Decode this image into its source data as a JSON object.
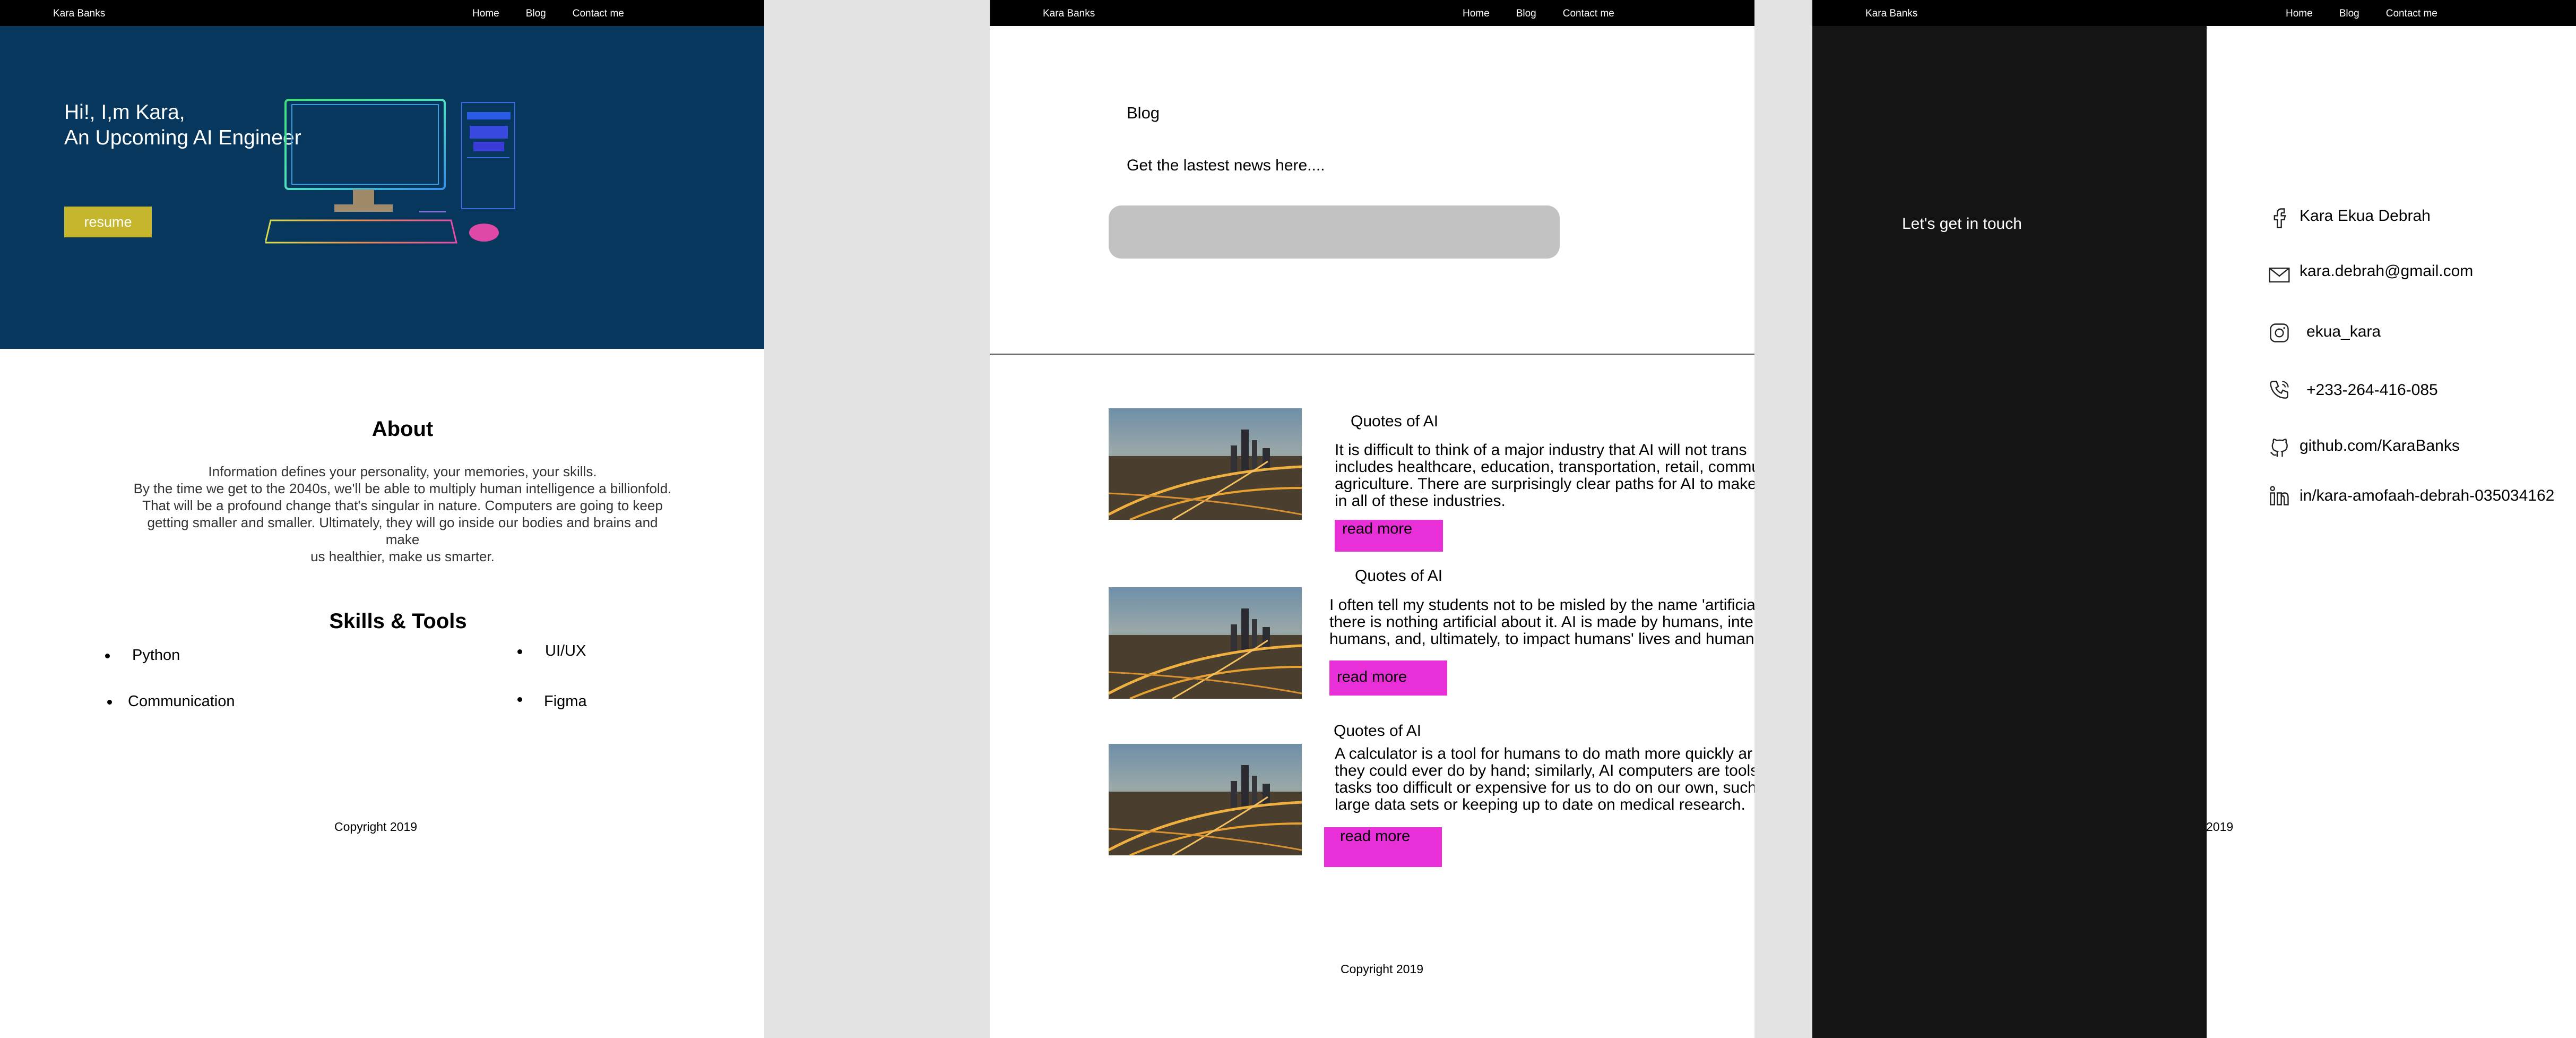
{
  "nav": {
    "brand": "Kara Banks",
    "links": [
      "Home",
      "Blog",
      "Contact me"
    ]
  },
  "home": {
    "hero_line1": "Hi!, I,m Kara,",
    "hero_line2": "An Upcoming AI Engineer",
    "resume_label": "resume",
    "about_title": "About",
    "about_lines": [
      "Information defines your personality, your memories, your skills.",
      "By the time we get to the 2040s, we'll be able to multiply human intelligence a billionfold.",
      "That will be a profound change that's singular in nature. Computers are going to keep",
      "getting smaller and smaller. Ultimately, they will go inside our bodies and brains and make",
      "us healthier, make us smarter."
    ],
    "skills_title": "Skills & Tools",
    "skills": [
      "Python",
      "UI/UX",
      "Communication",
      "Figma"
    ],
    "copyright": "Copyright 2019"
  },
  "blog": {
    "title": "Blog",
    "subtitle": "Get the lastest news here....",
    "posts": [
      {
        "title": "Quotes of AI",
        "lines": [
          "It is difficult to think of a major industry that AI will not trans",
          "includes healthcare, education, transportation, retail, commu",
          "agriculture. There are surprisingly clear paths for AI to make",
          "in all of these industries."
        ],
        "button": "read more"
      },
      {
        "title": "Quotes of AI",
        "lines": [
          "I often tell my students not to be misled by the name 'artificia",
          "there is nothing artificial about it. AI is made by humans, inte",
          "humans, and, ultimately, to impact humans' lives and human"
        ],
        "button": "read more"
      },
      {
        "title": "Quotes of AI",
        "lines": [
          "A calculator is a tool for humans to do math more quickly ar",
          "they could ever do by hand; similarly, AI computers are tools",
          "tasks too difficult or expensive for us to do on our own, such",
          "large data sets or keeping up to date on medical research."
        ],
        "button": "read more"
      }
    ],
    "copyright": "Copyright 2019"
  },
  "contact": {
    "heading": "Let's get in touch",
    "items": [
      {
        "icon": "facebook-icon",
        "text": "Kara Ekua Debrah"
      },
      {
        "icon": "mail-icon",
        "text": "kara.debrah@gmail.com"
      },
      {
        "icon": "instagram-icon",
        "text": "ekua_kara"
      },
      {
        "icon": "phone-icon",
        "text": "+233-264-416-085"
      },
      {
        "icon": "github-icon",
        "text": "github.com/KaraBanks"
      },
      {
        "icon": "linkedin-icon",
        "text": "in/kara-amofaah-debrah-035034162"
      }
    ],
    "copyright_fragment": "2019"
  },
  "colors": {
    "hero_bg": "#07375c",
    "resume_btn": "#c5b62d",
    "read_more_btn": "#e92fd8",
    "contact_dark": "#141414"
  }
}
